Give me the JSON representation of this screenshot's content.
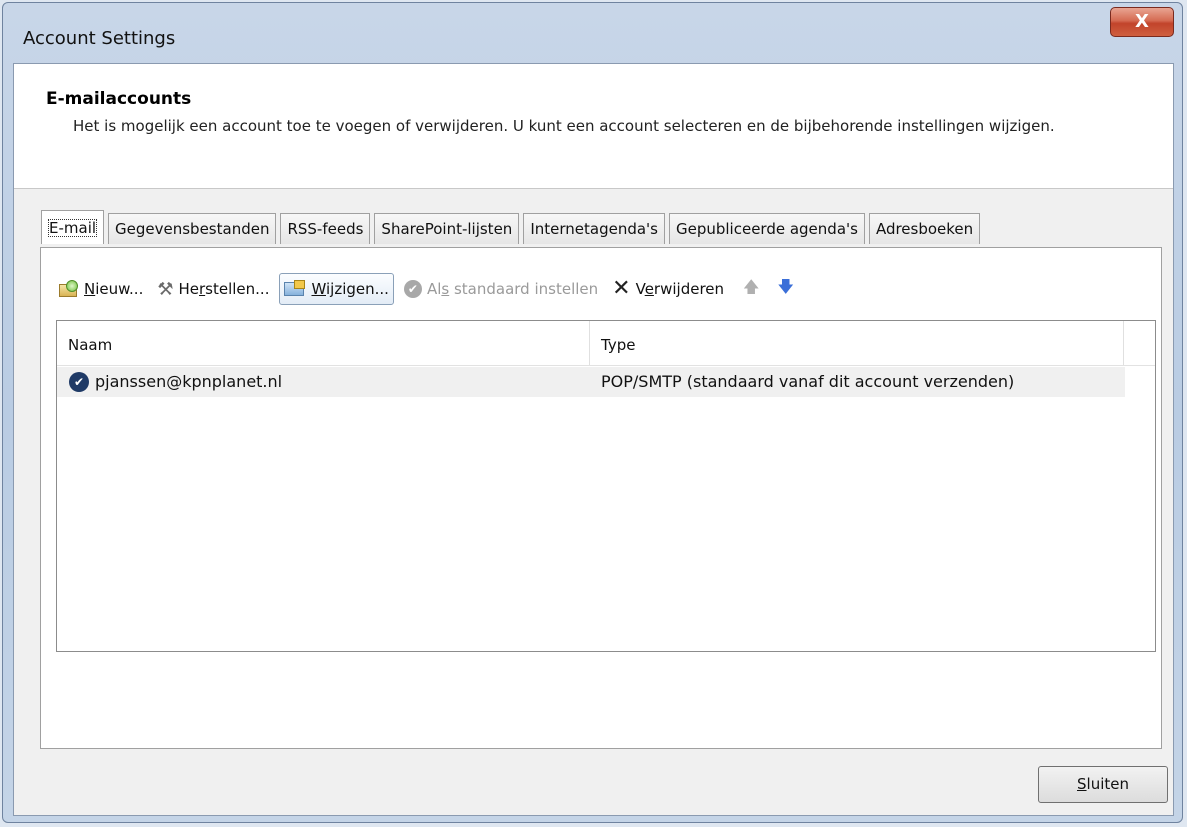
{
  "window": {
    "title": "Account Settings",
    "close_glyph": "X"
  },
  "header": {
    "title": "E-mailaccounts",
    "description": "Het is mogelijk een account toe te voegen of verwijderen. U kunt een account selecteren en de bijbehorende instellingen wijzigen."
  },
  "tabs": [
    {
      "label": "E-mail",
      "active": true
    },
    {
      "label": "Gegevensbestanden",
      "active": false
    },
    {
      "label": "RSS-feeds",
      "active": false
    },
    {
      "label": "SharePoint-lijsten",
      "active": false
    },
    {
      "label": "Internetagenda's",
      "active": false
    },
    {
      "label": "Gepubliceerde agenda's",
      "active": false
    },
    {
      "label": "Adresboeken",
      "active": false
    }
  ],
  "toolbar": {
    "new": {
      "accel": "N",
      "rest": "ieuw...",
      "icon": "new-account-icon"
    },
    "repair": {
      "pre": "He",
      "accel": "r",
      "rest": "stellen...",
      "icon": "tools-icon"
    },
    "change": {
      "accel": "W",
      "rest": "ijzigen...",
      "icon": "change-icon"
    },
    "set_default": {
      "pre": "Al",
      "accel": "s",
      "rest": " standaard instellen",
      "icon": "check-circle-icon",
      "enabled": false
    },
    "remove": {
      "pre": "V",
      "accel": "e",
      "rest": "rwijderen",
      "icon": "x-icon"
    },
    "move_up_icon": "arrow-up-icon",
    "move_down_icon": "arrow-down-icon"
  },
  "accounts_list": {
    "columns": [
      "Naam",
      "Type"
    ],
    "rows": [
      {
        "name": "pjanssen@kpnplanet.nl",
        "type": "POP/SMTP (standaard vanaf dit account verzenden)",
        "is_default": true
      }
    ]
  },
  "footer": {
    "close_pre": "",
    "close_accel": "S",
    "close_rest": "luiten"
  },
  "colors": {
    "accent_blue": "#3b6fd8",
    "close_red": "#c2442b"
  }
}
